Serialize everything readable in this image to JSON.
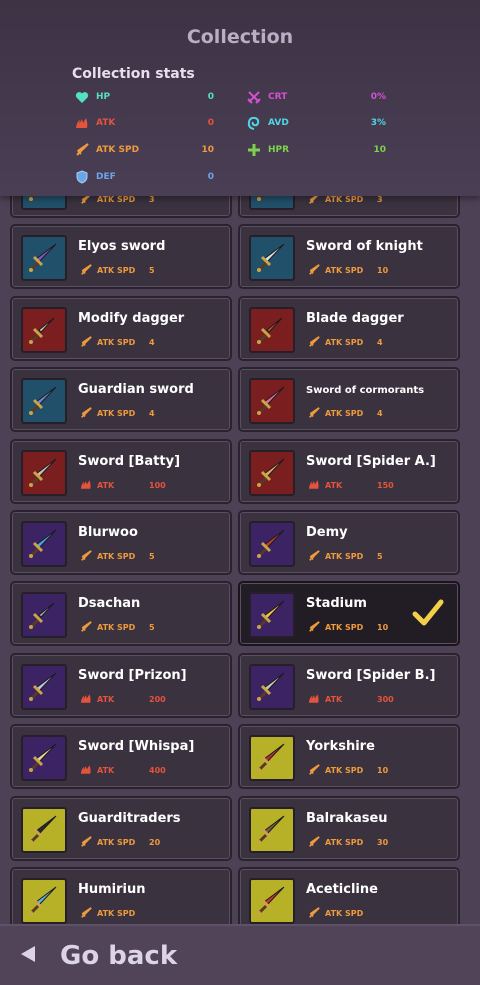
{
  "header": {
    "title": "Collection",
    "stats_title": "Collection stats",
    "stats": {
      "hp": {
        "label": "HP",
        "value": "0",
        "color": "#54e0c2",
        "icon": "heart-icon"
      },
      "atk": {
        "label": "ATK",
        "value": "0",
        "color": "#e5533d",
        "icon": "claw-icon"
      },
      "atkspd": {
        "label": "ATK SPD",
        "value": "10",
        "color": "#ee9a3e",
        "icon": "sword-icon"
      },
      "def": {
        "label": "DEF",
        "value": "0",
        "color": "#6aa7e8",
        "icon": "shield-icon"
      },
      "crt": {
        "label": "CRT",
        "value": "0%",
        "color": "#d451d1",
        "icon": "crossed-swords-icon"
      },
      "avd": {
        "label": "AVD",
        "value": "3%",
        "color": "#4fd6e6",
        "icon": "swirl-icon"
      },
      "hpr": {
        "label": "HPR",
        "value": "10",
        "color": "#7ed14e",
        "icon": "plus-icon"
      }
    }
  },
  "items": [
    {
      "name": "",
      "stat": "ATK SPD",
      "value": "3",
      "bg": "blue",
      "blade": "#8d97b3",
      "icon": "dagger-icon"
    },
    {
      "name": "",
      "stat": "ATK SPD",
      "value": "3",
      "bg": "blue",
      "blade": "#3f6bd1",
      "icon": "dagger-icon"
    },
    {
      "name": "Elyos sword",
      "stat": "ATK SPD",
      "value": "5",
      "bg": "blue",
      "blade": "#7a55c9",
      "icon": "sword-icon"
    },
    {
      "name": "Sword of knight",
      "stat": "ATK SPD",
      "value": "10",
      "bg": "blue",
      "blade": "#d9dde4",
      "icon": "sword-icon"
    },
    {
      "name": "Modify dagger",
      "stat": "ATK SPD",
      "value": "4",
      "bg": "red",
      "blade": "#e7d9b6",
      "icon": "dagger-icon"
    },
    {
      "name": "Blade dagger",
      "stat": "ATK SPD",
      "value": "4",
      "bg": "red",
      "blade": "#c9602f",
      "icon": "dagger-icon"
    },
    {
      "name": "Guardian sword",
      "stat": "ATK SPD",
      "value": "4",
      "bg": "blue",
      "blade": "#6f87c8",
      "icon": "sword-icon"
    },
    {
      "name": "Sword of cormorants",
      "stat": "ATK SPD",
      "value": "4",
      "bg": "red",
      "blade": "#e06b8c",
      "icon": "sword-icon"
    },
    {
      "name": "Sword [Batty]",
      "stat": "ATK",
      "value": "100",
      "bg": "red",
      "blade": "#c8c0a8",
      "icon": "sword-icon"
    },
    {
      "name": "Sword [Spider A.]",
      "stat": "ATK",
      "value": "150",
      "bg": "red",
      "blade": "#d9a85a",
      "icon": "sword-icon"
    },
    {
      "name": "Blurwoo",
      "stat": "ATK SPD",
      "value": "5",
      "bg": "purple",
      "blade": "#4aa3e0",
      "icon": "sword-icon"
    },
    {
      "name": "Demy",
      "stat": "ATK SPD",
      "value": "5",
      "bg": "purple",
      "blade": "#b8402f",
      "icon": "sword-icon"
    },
    {
      "name": "Dsachan",
      "stat": "ATK SPD",
      "value": "5",
      "bg": "purple",
      "blade": "#b0b4bc",
      "icon": "dagger-icon"
    },
    {
      "name": "Stadium",
      "stat": "ATK SPD",
      "value": "10",
      "bg": "purple",
      "blade": "#f0c23a",
      "icon": "sword-icon",
      "selected": true
    },
    {
      "name": "Sword [Prizon]",
      "stat": "ATK",
      "value": "200",
      "bg": "purple",
      "blade": "#b9c6dc",
      "icon": "sword-icon"
    },
    {
      "name": "Sword [Spider B.]",
      "stat": "ATK",
      "value": "300",
      "bg": "purple",
      "blade": "#c8c4b0",
      "icon": "sword-icon"
    },
    {
      "name": "Sword [Whispa]",
      "stat": "ATK",
      "value": "400",
      "bg": "purple",
      "blade": "#e6d49a",
      "icon": "sword-icon"
    },
    {
      "name": "Yorkshire",
      "stat": "ATK SPD",
      "value": "10",
      "bg": "yellow",
      "blade": "#b83028",
      "icon": "sword-icon"
    },
    {
      "name": "Guarditraders",
      "stat": "ATK SPD",
      "value": "20",
      "bg": "yellow",
      "blade": "#2a2a2a",
      "icon": "sword-icon"
    },
    {
      "name": "Balrakaseu",
      "stat": "ATK SPD",
      "value": "30",
      "bg": "yellow",
      "blade": "#7a5a3c",
      "icon": "sword-icon"
    },
    {
      "name": "Humiriun",
      "stat": "ATK SPD",
      "value": "",
      "bg": "yellow",
      "blade": "#5fb4d6",
      "icon": "sword-icon"
    },
    {
      "name": "Aceticline",
      "stat": "ATK SPD",
      "value": "",
      "bg": "yellow",
      "blade": "#c23a2a",
      "icon": "sword-icon"
    }
  ],
  "footer": {
    "back_label": "Go back",
    "icon": "back-arrow-icon"
  }
}
